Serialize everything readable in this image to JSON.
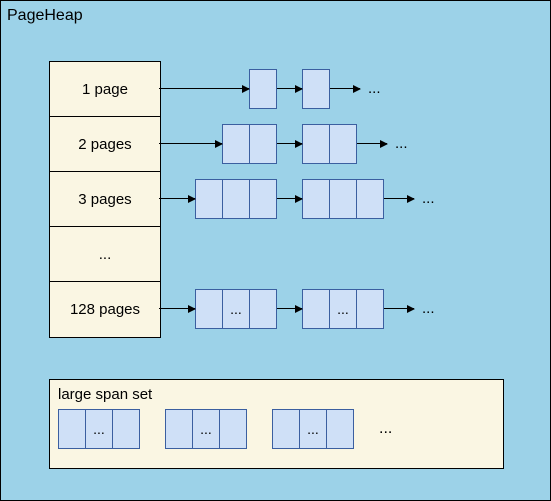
{
  "title": "PageHeap",
  "rows": [
    {
      "label": "1 page",
      "pages": 1,
      "ellipsisInBox": false
    },
    {
      "label": "2 pages",
      "pages": 2,
      "ellipsisInBox": false
    },
    {
      "label": "3 pages",
      "pages": 3,
      "ellipsisInBox": false
    },
    {
      "label": "...",
      "pages": 0,
      "ellipsisInBox": false
    },
    {
      "label": "128 pages",
      "pages": 3,
      "ellipsisInBox": true
    }
  ],
  "trailing": "...",
  "large": {
    "label": "large span set",
    "boxes": 3,
    "pagesPerBox": 3,
    "ellipsisInBox": true,
    "trailing": "..."
  }
}
